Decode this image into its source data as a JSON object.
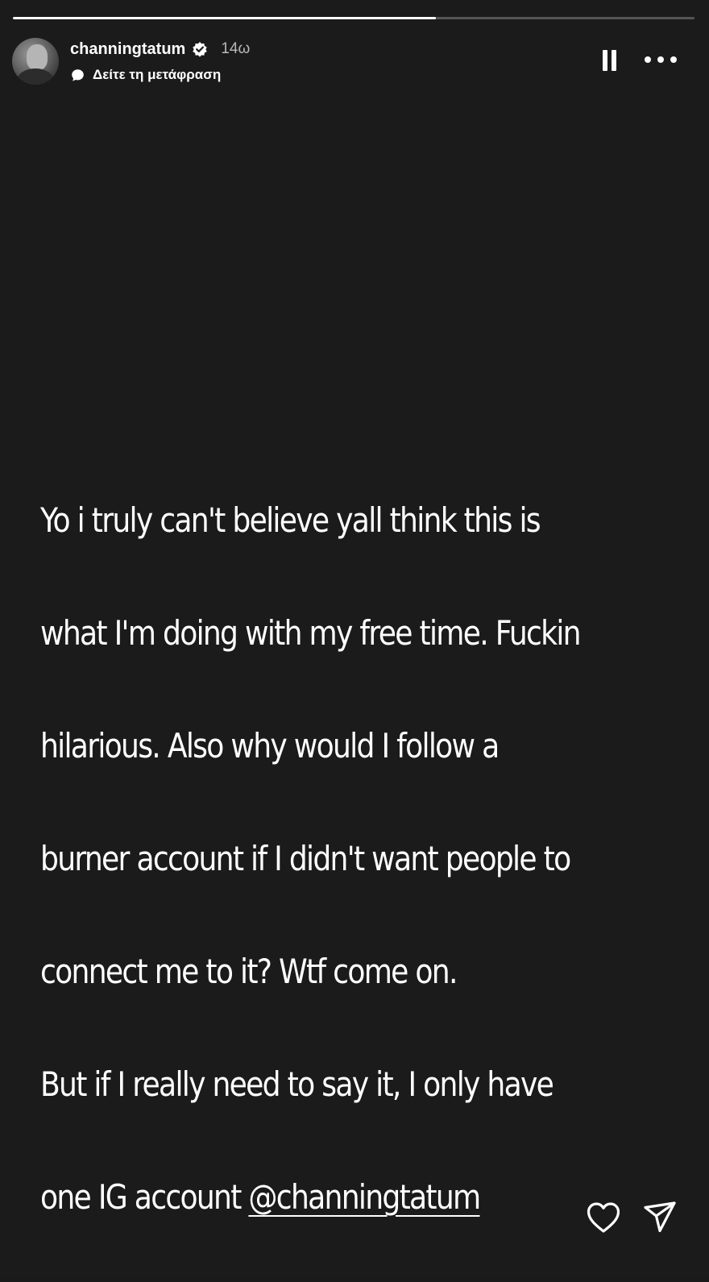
{
  "story": {
    "progress_fraction": 0.62,
    "author": {
      "username": "channingtatum",
      "verified": true,
      "posted_ago": "14ω",
      "avatar_icon": "profile-photo"
    },
    "translate_label": "Δείτε τη μετάφραση",
    "controls": {
      "pause_icon": "pause-icon",
      "more_icon": "more-options-icon"
    },
    "text_lines": [
      "Yo i truly can't believe yall think this is",
      "what I'm doing with my free time. Fuckin",
      "hilarious. Also why would I follow a",
      "burner account if I didn't want people to",
      "connect me to it? Wtf come on.",
      "But if I really need to say it, I only have",
      "one IG account "
    ],
    "mention": "@channingtatum",
    "footer": {
      "like_icon": "heart-icon",
      "share_icon": "paper-plane-icon"
    }
  },
  "colors": {
    "background": "#1b1b1b",
    "text": "#ffffff",
    "muted": "#b8b8b8",
    "progress_track": "#555555"
  }
}
